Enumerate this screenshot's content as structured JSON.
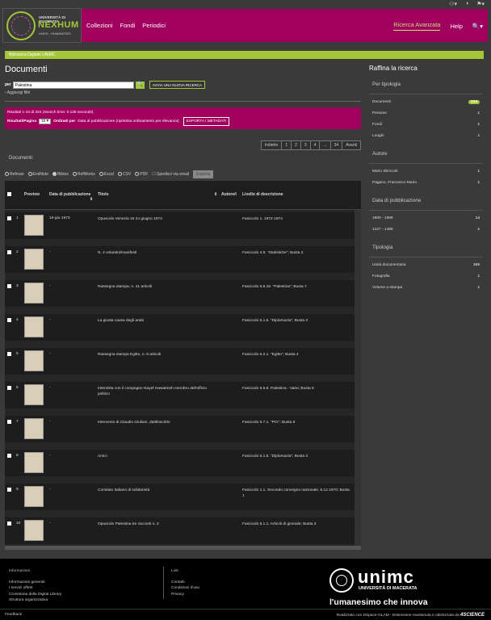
{
  "colors": {
    "brand": "#a1005f",
    "accent": "#a4c639",
    "bg": "#3a3a3a"
  },
  "topbar": {
    "icons": [
      "user-icon",
      "contrast-icon",
      "flag-icon"
    ]
  },
  "logo": {
    "line1": "UNIVERSITÀ DI MACERATA",
    "word": "NEXHUM",
    "line3": "LINKS · HUMANITIES"
  },
  "nav": {
    "items": [
      "Collezioni",
      "Fondi",
      "Periodici"
    ],
    "advanced": "Ricerca Avanzata",
    "help": "Help"
  },
  "breadcrumb": "Biblioteca Digitale UNIMC",
  "main": {
    "title": "Documenti",
    "search_label": "per",
    "search_value": "Palestina",
    "new_search": "AVVIA UNA NUOVA RICERCA",
    "add_filters": "Aggiungi filtri",
    "results_text": "Risultati 1-10 di 334 (Search time: 0.135 seconds).",
    "per_page_label": "Risultati/Pagina",
    "per_page_value": "10",
    "sort_label": "Ordinati per",
    "sort_value": "Data di pubblicazione (ripristina ordinamento per rilevanza)",
    "export_meta": "ESPORTA I METADATI",
    "pager": [
      "Indietro",
      "1",
      "2",
      "3",
      "4",
      "...",
      "34",
      "Avanti"
    ],
    "docs_label": "Documenti:",
    "exports": [
      "Refman",
      "EndNote",
      "Bibtex",
      "RefWorks",
      "Excel",
      "CSV",
      "PDF"
    ],
    "send_email": "Spedisci via email",
    "send_btn": "Esporta",
    "columns": {
      "preview": "Preview",
      "date": "Data di pubblicazione",
      "title": "Titolo",
      "author": "Autore/i",
      "level": "Livello di descrizione"
    },
    "rows": [
      {
        "n": "1",
        "date": "16-giu-1973",
        "title": "Opuscolo Venezia 16 24 giugno 1973",
        "level": "Fascicolo 1. 1972-1974"
      },
      {
        "n": "2",
        "date": "-",
        "title": "N. 4 volantini/manifesti",
        "level": "Fascicolo 4.9. \"Statistiche\"; Busta 2"
      },
      {
        "n": "3",
        "date": "-",
        "title": "Rassegna stampa, n. 41 articoli",
        "level": "Fascicolo 5.6.16. \"Palestina\"; Busta 7"
      },
      {
        "n": "4",
        "date": "-",
        "title": "La giusta causa degli arabi",
        "level": "Fascicolo 5.1.5. \"Diplomazia\"; Busta 3"
      },
      {
        "n": "5",
        "date": "-",
        "title": "Rassegna stampa Egitto, n. 8 articoli",
        "level": "Fascicolo 5.2.1. \"Egitto\"; Busta 4"
      },
      {
        "n": "6",
        "date": "-",
        "title": "Intervista con il compagno Nayef Hawatmeh membro dell'ufficio politico",
        "level": "Fascicolo 5.6.8. Palestina - Varie; Busta 6"
      },
      {
        "n": "7",
        "date": "-",
        "title": "Intervento di Claudio Giuliani, dattiloscritto",
        "level": "Fascicolo 5.7.1. \"PCI\"; Busta 8"
      },
      {
        "n": "8",
        "date": "-",
        "title": "Amici",
        "level": "Fascicolo 5.1.5. \"Diplomazia\"; Busta 3"
      },
      {
        "n": "9",
        "date": "-",
        "title": "Comitato Italiano di solidarietà",
        "level": "Fascicolo 1.1. Secondo convegno nazionale, 5.12.1970; Busta 1"
      },
      {
        "n": "10",
        "date": "-",
        "title": "Opuscolo Palestina tre racconti n. 2",
        "level": "Fascicolo 5.1.1. Articoli di giornale; Busta 3"
      }
    ]
  },
  "side": {
    "title": "Raffina la ricerca",
    "tipologia": {
      "title": "Per tipologia",
      "items": [
        {
          "l": "Documenti",
          "c": "334"
        },
        {
          "l": "Persone",
          "c": "1"
        },
        {
          "l": "Fondi",
          "c": "1"
        },
        {
          "l": "Luoghi",
          "c": "1"
        }
      ]
    },
    "autore": {
      "title": "Autore",
      "items": [
        {
          "l": "Mario Sbriccoli",
          "c": "1"
        },
        {
          "l": "Pagano, Francesco Mario",
          "c": "1"
        }
      ]
    },
    "data": {
      "title": "Data di pubblicazione",
      "items": [
        {
          "l": "1900 - 1999",
          "c": "14"
        },
        {
          "l": "1427 - 1499",
          "c": "2"
        }
      ]
    },
    "tipo": {
      "title": "Tipologia",
      "items": [
        {
          "l": "Unità documentaria",
          "c": "309"
        },
        {
          "l": "Fotografia",
          "c": "1"
        },
        {
          "l": "Volume a stampa",
          "c": "1"
        }
      ]
    }
  },
  "footer": {
    "info_title": "Informazioni",
    "info": [
      "Informazioni generali",
      "I servizi offerti",
      "Cronistoria della Digital Library",
      "Struttura organizzativa"
    ],
    "link_title": "Link",
    "links": [
      "Contatti",
      "Condizioni d'uso",
      "Privacy"
    ],
    "unimc": "unimc",
    "unimc_sub": "UNIVERSITÀ DI MACERATA",
    "motto": "l'umanesimo che innova",
    "feedback": "Feedback",
    "credit": "Realizzato con DSpace-GLAM - Estensione mantenuta e ottimizzata da",
    "credit_brand": "4SCIENCE"
  }
}
